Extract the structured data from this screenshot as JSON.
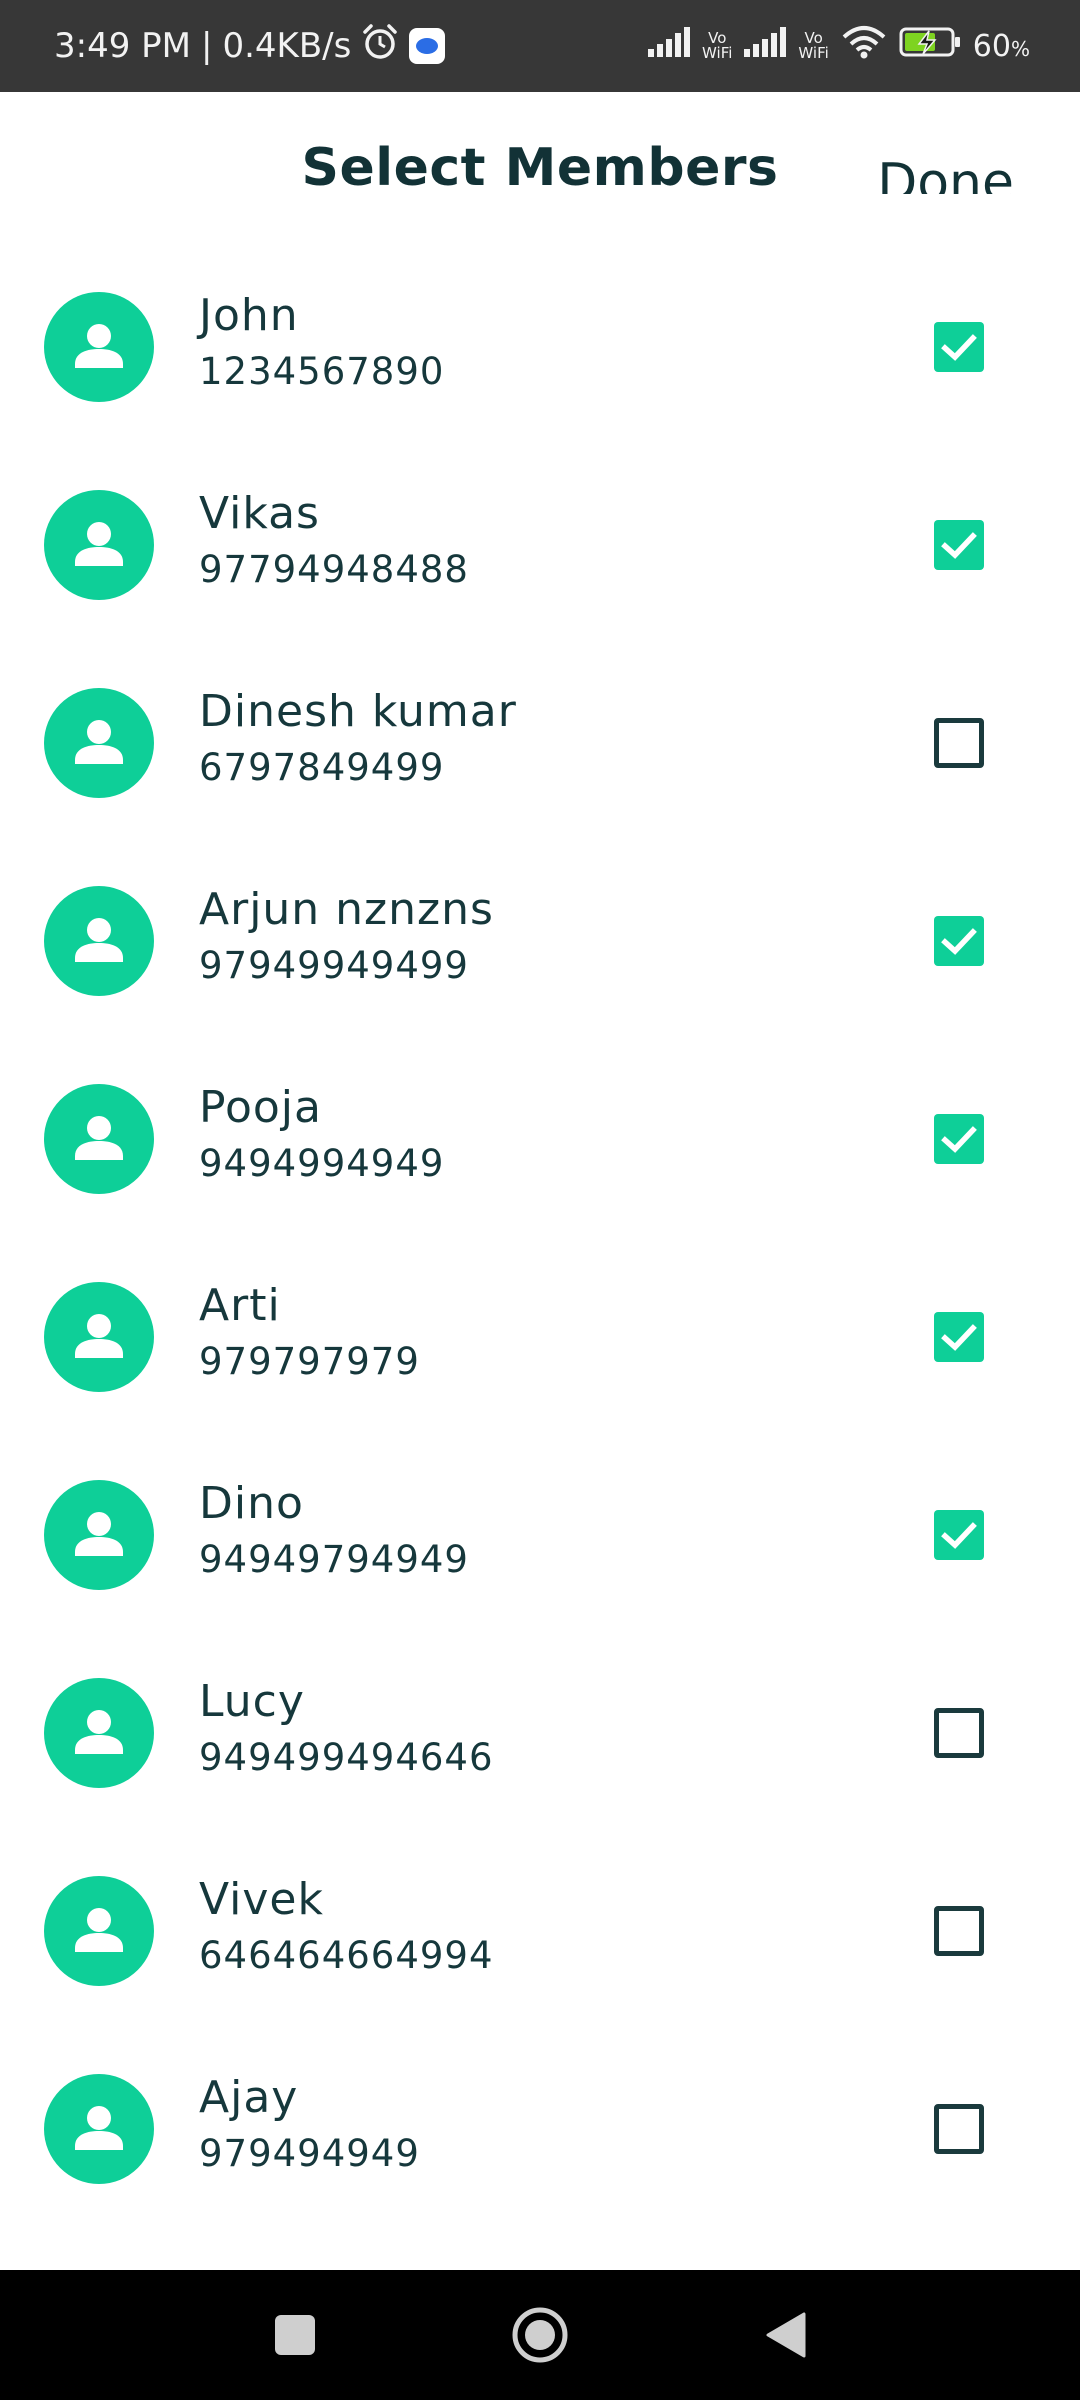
{
  "status_bar": {
    "time": "3:49 PM",
    "separator": "|",
    "speed": "0.4KB/s",
    "vowifi_top": "Vo",
    "vowifi_bottom": "WiFi",
    "battery": "60",
    "battery_unit": "%",
    "icons": [
      "alarm-icon",
      "messages-app-icon",
      "signal-icon",
      "wifi-icon",
      "battery-charging-icon"
    ]
  },
  "header": {
    "title": "Select Members",
    "done_label": "Done"
  },
  "members": [
    {
      "name": "John",
      "phone": "1234567890",
      "checked": true
    },
    {
      "name": "Vikas",
      "phone": "97794948488",
      "checked": true
    },
    {
      "name": "Dinesh kumar",
      "phone": "6797849499",
      "checked": false
    },
    {
      "name": "Arjun nznzns",
      "phone": "97949949499",
      "checked": true
    },
    {
      "name": "Pooja",
      "phone": "9494994949",
      "checked": true
    },
    {
      "name": "Arti",
      "phone": "979797979",
      "checked": true
    },
    {
      "name": "Dino",
      "phone": "94949794949",
      "checked": true
    },
    {
      "name": "Lucy",
      "phone": "949499494646",
      "checked": false
    },
    {
      "name": "Vivek",
      "phone": "646464664994",
      "checked": false
    },
    {
      "name": "Ajay",
      "phone": "979494949",
      "checked": false
    }
  ],
  "nav": {
    "icons": [
      "recents-square-icon",
      "home-circle-icon",
      "back-triangle-icon"
    ]
  },
  "colors": {
    "accent": "#0ecf98",
    "text": "#16383c",
    "status_bar": "#373737",
    "nav_bar": "#000000"
  }
}
